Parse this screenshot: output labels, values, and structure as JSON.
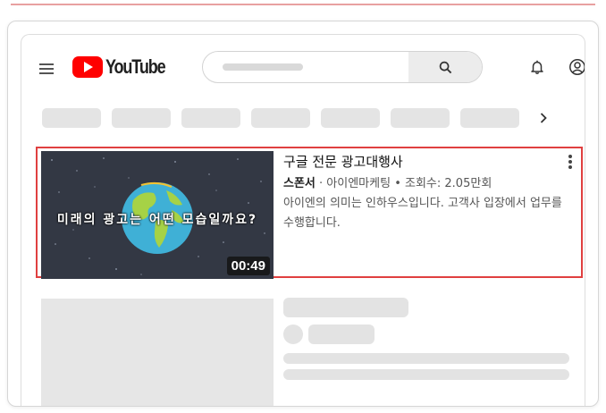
{
  "header": {
    "logo_text": "YouTube",
    "menu_icon": "hamburger-menu-icon",
    "search_icon": "search-icon",
    "notifications_icon": "bell-icon",
    "account_icon": "account-circle-icon",
    "brand_color": "#ff0000"
  },
  "chips": {
    "count": 7,
    "next_icon": "chevron-right-icon"
  },
  "video": {
    "thumbnail_text": "미래의 광고는 어떤 모습일까요?",
    "duration": "00:49",
    "title": "구글 전문 광고대행사",
    "sponsor_label": "스폰서",
    "channel": "아이엔마케팅",
    "views": "조회수: 2.05만회",
    "description": "아이엔의 의미는 인하우스입니다. 고객사 입장에서 업무를 수행합니다.",
    "more_icon": "more-vertical-icon",
    "highlight_color": "#e04040"
  }
}
